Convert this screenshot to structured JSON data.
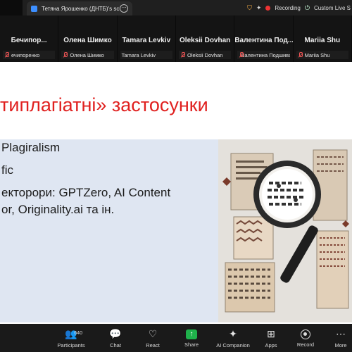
{
  "window": {
    "tab_title": "Тетяна Ярошенко (ДНТБ)'s scree",
    "recording_label": "Recording",
    "custom_label": "Custom Live S"
  },
  "participants": [
    {
      "name": "Бечипор...",
      "label": "ечипоренко"
    },
    {
      "name": "Олена Шимко",
      "label": "Олена Шимко"
    },
    {
      "name": "Tamara Levkiv",
      "label": "Tamara Levkiv"
    },
    {
      "name": "Oleksii Dovhan",
      "label": "Oleksii Dovhan"
    },
    {
      "name": "Валентина Под...",
      "label": "Валентина Подшивал..."
    },
    {
      "name": "Mariia Shu",
      "label": "Mariia Shu"
    }
  ],
  "slide": {
    "title": "типлагіатні» застосунки",
    "bullets": [
      "Plagiralism",
      "fic",
      "екторори: GPTZero, AI Content",
      "or, Originality.ai та ін."
    ]
  },
  "toolbar": {
    "participant_count": "640",
    "items": [
      {
        "label": "Participants",
        "icon": "people-icon"
      },
      {
        "label": "Chat",
        "icon": "chat-icon"
      },
      {
        "label": "React",
        "icon": "heart-icon"
      },
      {
        "label": "Share",
        "icon": "share-icon"
      },
      {
        "label": "AI Companion",
        "icon": "sparkle-icon"
      },
      {
        "label": "Apps",
        "icon": "apps-icon"
      },
      {
        "label": "Record",
        "icon": "record-icon"
      },
      {
        "label": "More",
        "icon": "more-icon"
      }
    ]
  },
  "colors": {
    "title_red": "#e0201f",
    "panel_blue": "#dfe6f2",
    "share_green": "#1fb14b",
    "recording_red": "#ee3333"
  }
}
